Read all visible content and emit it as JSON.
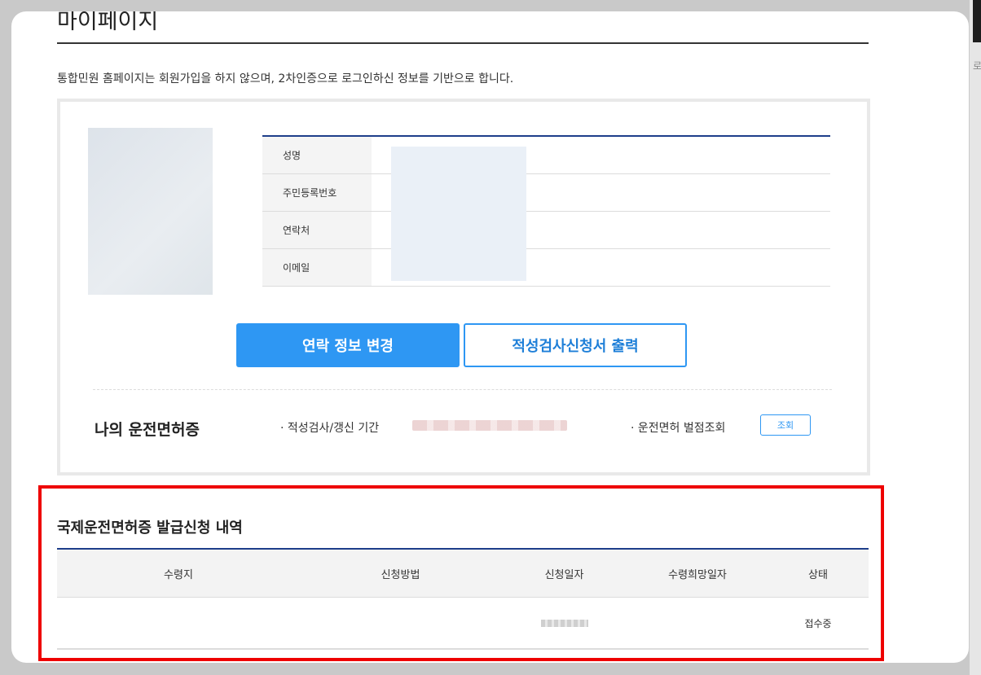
{
  "page": {
    "title": "마이페이지",
    "intro": "통합민원 홈페이지는 회원가입을 하지 않으며, 2차인증으로 로그인하신 정보를 기반으로 합니다."
  },
  "profile": {
    "fields": [
      {
        "label": "성명"
      },
      {
        "label": "주민등록번호"
      },
      {
        "label": "연락처"
      },
      {
        "label": "이메일"
      }
    ]
  },
  "actions": {
    "change_contact": "연락 정보 변경",
    "print_form": "적성검사신청서 출력"
  },
  "license": {
    "title": "나의 운전면허증",
    "period_label": "· 적성검사/갱신 기간",
    "points_label": "· 운전면허 벌점조회",
    "points_button": "조회"
  },
  "history": {
    "title": "국제운전면허증 발급신청 내역",
    "columns": [
      "수령지",
      "신청방법",
      "신청일자",
      "수령희망일자",
      "상태"
    ],
    "rows": [
      {
        "place": "",
        "method": "",
        "date": "",
        "desired_date": "",
        "status": "접수중"
      }
    ]
  },
  "right_strip": {
    "fragment": "로"
  },
  "colors": {
    "primary": "#2e97f3",
    "table_header_line": "#1e3e8a",
    "highlight_frame": "#ee0000"
  }
}
